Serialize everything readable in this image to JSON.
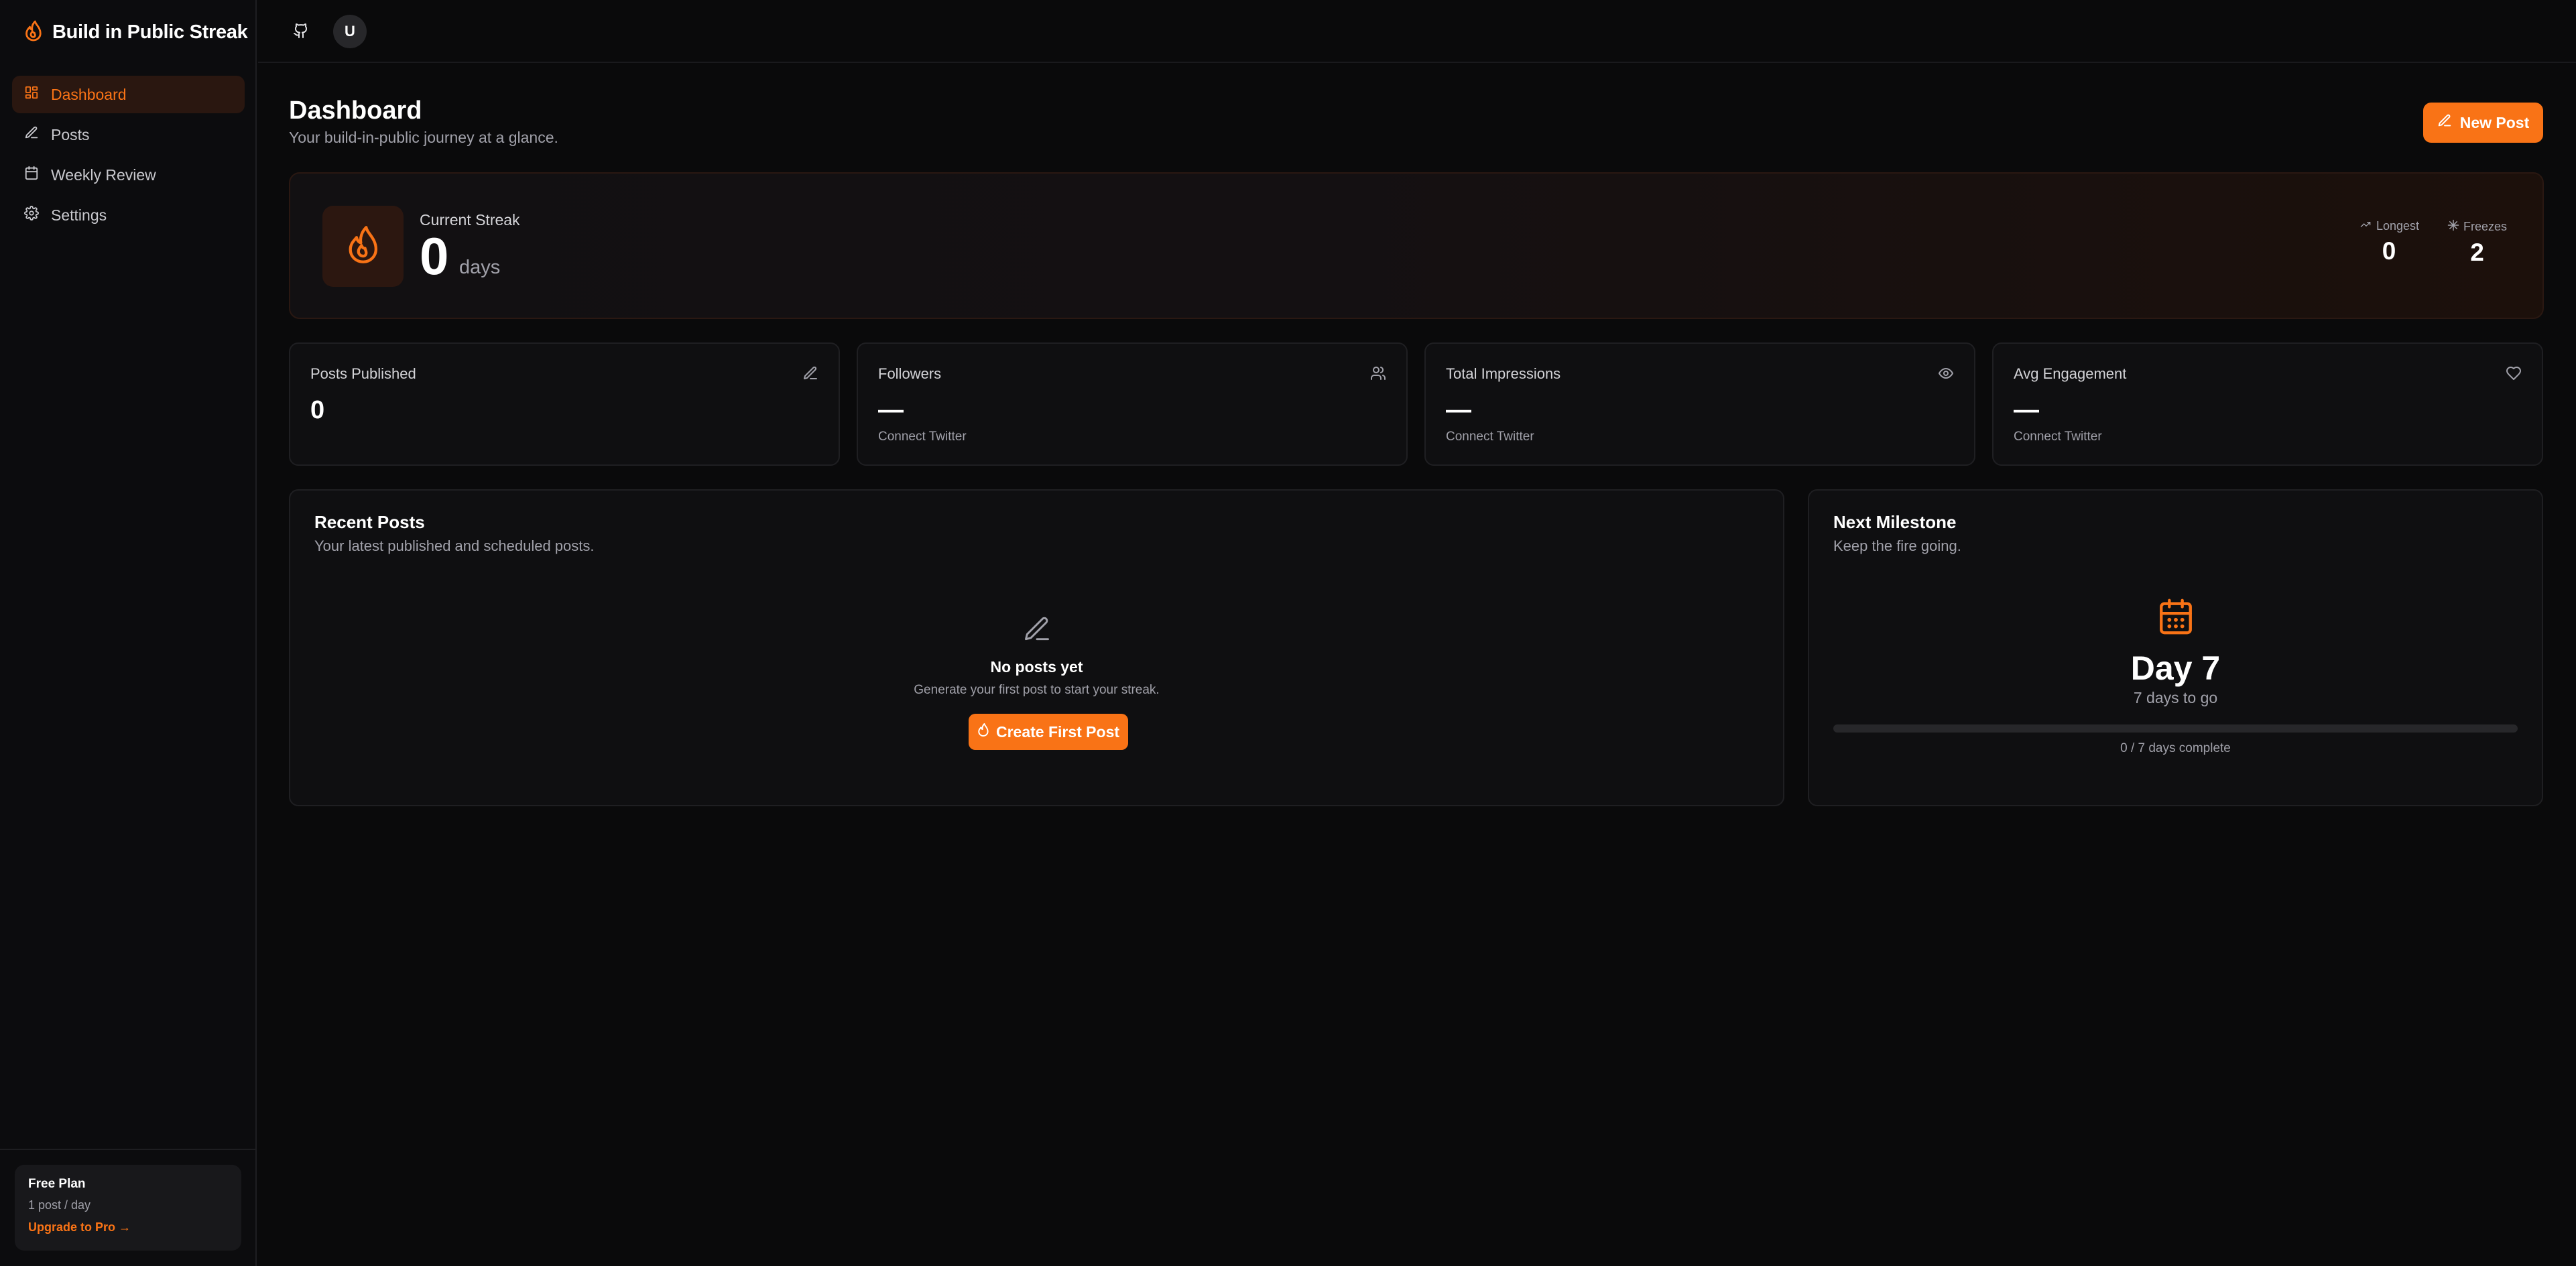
{
  "app": {
    "title": "Build in Public Streak"
  },
  "sidebar": {
    "items": [
      {
        "label": "Dashboard",
        "icon": "dashboard-icon",
        "active": true
      },
      {
        "label": "Posts",
        "icon": "pencil-icon",
        "active": false
      },
      {
        "label": "Weekly Review",
        "icon": "calendar-icon",
        "active": false
      },
      {
        "label": "Settings",
        "icon": "gear-icon",
        "active": false
      }
    ],
    "plan": {
      "title": "Free Plan",
      "limit": "1 post / day",
      "upgrade_label": "Upgrade to Pro →"
    }
  },
  "topbar": {
    "avatar_initial": "U",
    "icons": [
      "github-icon"
    ]
  },
  "header": {
    "title": "Dashboard",
    "subtitle": "Your build-in-public journey at a glance.",
    "new_post_label": "New Post"
  },
  "streak": {
    "label": "Current Streak",
    "value": "0",
    "unit": "days",
    "longest_label": "Longest",
    "longest_value": "0",
    "freezes_label": "Freezes",
    "freezes_value": "2"
  },
  "stats": [
    {
      "label": "Posts Published",
      "value": "0",
      "sub": "",
      "icon": "pencil-icon"
    },
    {
      "label": "Followers",
      "value": "—",
      "sub": "Connect Twitter",
      "icon": "users-icon"
    },
    {
      "label": "Total Impressions",
      "value": "—",
      "sub": "Connect Twitter",
      "icon": "eye-icon"
    },
    {
      "label": "Avg Engagement",
      "value": "—",
      "sub": "Connect Twitter",
      "icon": "heart-icon"
    }
  ],
  "recent_posts": {
    "title": "Recent Posts",
    "subtitle": "Your latest published and scheduled posts.",
    "empty_title": "No posts yet",
    "empty_sub": "Generate your first post to start your streak.",
    "create_label": "Create First Post"
  },
  "milestone": {
    "title": "Next Milestone",
    "subtitle": "Keep the fire going.",
    "day_label": "Day 7",
    "to_go": "7 days to go",
    "progress_text": "0 / 7 days complete",
    "progress_fraction": 0
  },
  "colors": {
    "accent": "#f97316",
    "background": "#0a0a0b",
    "card": "#0f0f11"
  }
}
